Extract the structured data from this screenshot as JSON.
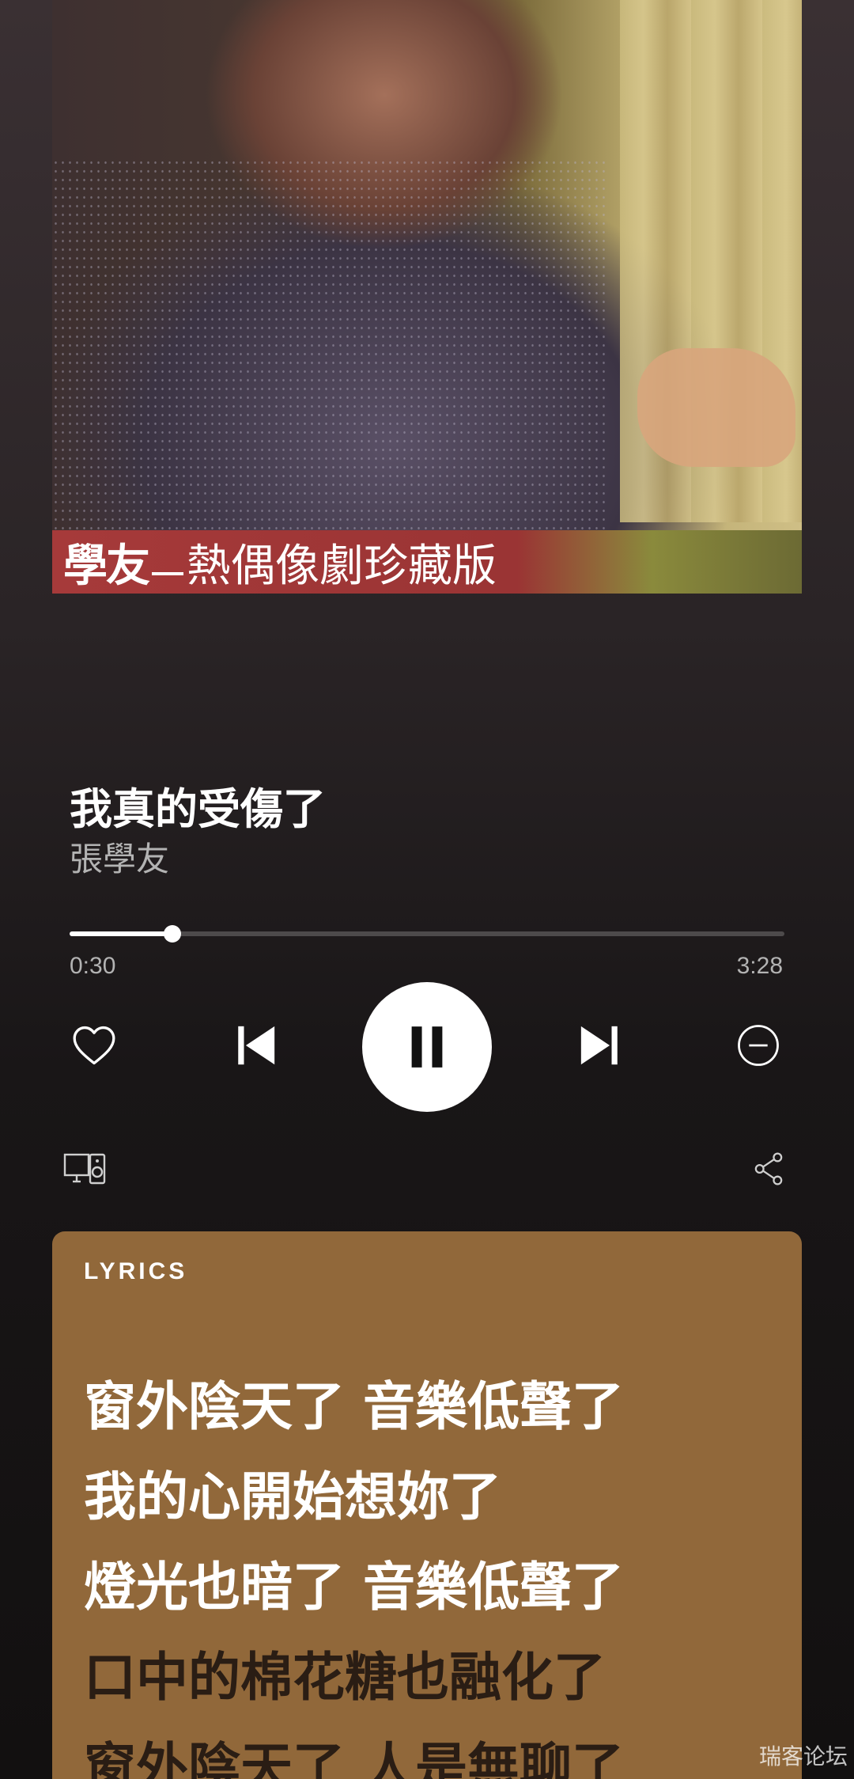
{
  "album": {
    "banner_brand": "學友",
    "banner_subtitle": "熱偶像劇珍藏版"
  },
  "track": {
    "title": "我真的受傷了",
    "artist": "張學友"
  },
  "playback": {
    "elapsed": "0:30",
    "duration": "3:28",
    "progress_fraction": 0.144,
    "state": "playing"
  },
  "controls": {
    "like_icon": "heart-outline-icon",
    "previous_icon": "skip-previous-icon",
    "pause_icon": "pause-icon",
    "next_icon": "skip-next-icon",
    "hide_icon": "minus-circle-icon",
    "devices_icon": "connect-devices-icon",
    "share_icon": "share-icon"
  },
  "lyrics": {
    "label": "LYRICS",
    "card_color": "#91683a",
    "lines": [
      {
        "text": "窗外陰天了 音樂低聲了",
        "state": "sung"
      },
      {
        "text": "我的心開始想妳了",
        "state": "sung"
      },
      {
        "text": "燈光也暗了 音樂低聲了",
        "state": "sung"
      },
      {
        "text": "口中的棉花糖也融化了",
        "state": "upcoming"
      },
      {
        "text": "窗外陰天了 人是無聊了",
        "state": "upcoming"
      }
    ]
  },
  "watermark": {
    "text": "瑞客论坛"
  }
}
